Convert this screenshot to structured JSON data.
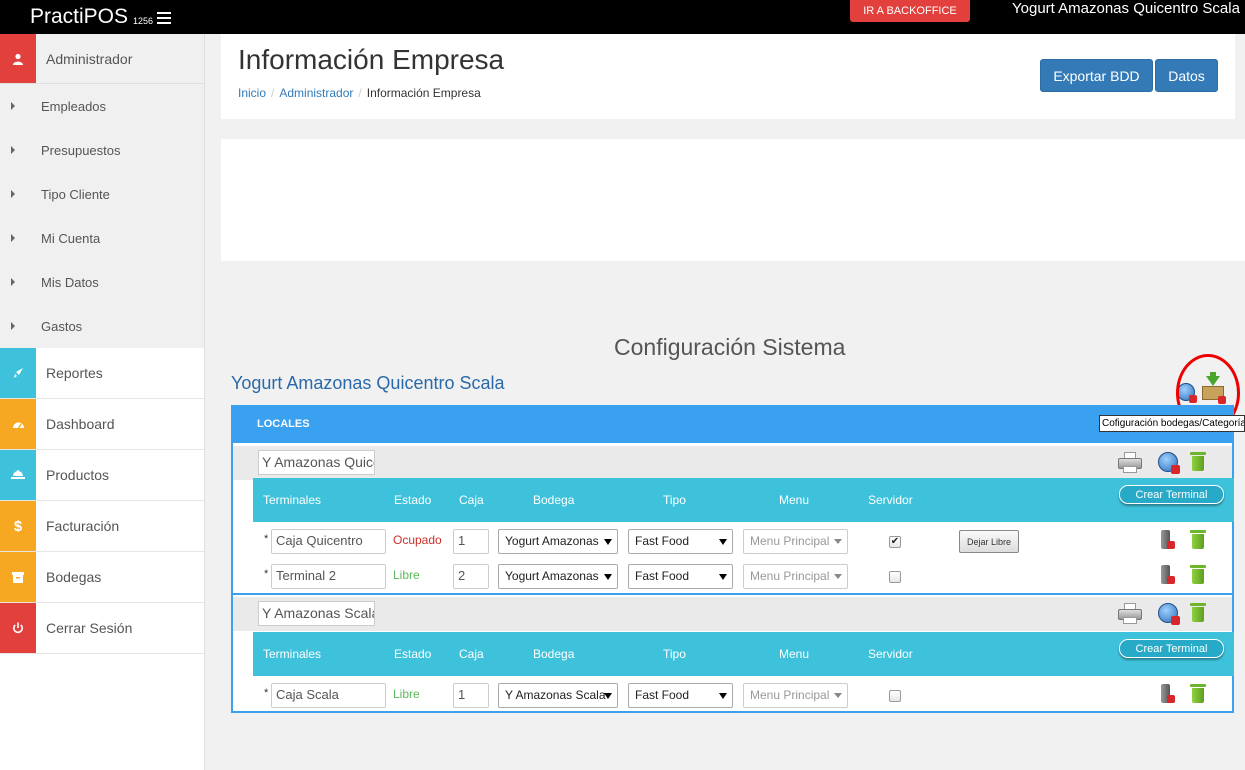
{
  "topbar": {
    "brand": "PractiPOS",
    "version": "1256",
    "backoffice_label": "IR A BACKOFFICE",
    "store_name": "Yogurt Amazonas Quicentro Scala"
  },
  "sidebar": {
    "section": "Administrador",
    "subitems": [
      "Empleados",
      "Presupuestos",
      "Tipo Cliente",
      "Mi Cuenta",
      "Mis Datos",
      "Gastos"
    ],
    "items": [
      {
        "label": "Reportes",
        "color": "#3ec2db",
        "icon": "rocket-icon"
      },
      {
        "label": "Dashboard",
        "color": "#f7a823",
        "icon": "dashboard-icon"
      },
      {
        "label": "Productos",
        "color": "#3ec2db",
        "icon": "products-icon"
      },
      {
        "label": "Facturación",
        "color": "#f7a823",
        "icon": "dollar-icon"
      },
      {
        "label": "Bodegas",
        "color": "#f7a823",
        "icon": "warehouse-icon"
      },
      {
        "label": "Cerrar Sesión",
        "color": "#e2403d",
        "icon": "power-icon"
      }
    ]
  },
  "header": {
    "title": "Información Empresa",
    "breadcrumb": [
      "Inicio",
      "Administrador",
      "Información Empresa"
    ],
    "export_label": "Exportar BDD",
    "datos_label": "Datos"
  },
  "config": {
    "title": "Configuración Sistema",
    "store_title": "Yogurt Amazonas Quicentro Scala",
    "tooltip": "Cofiguración bodegas/Categorías",
    "locales_label": "LOCALES"
  },
  "table_headers": {
    "terminales": "Terminales",
    "estado": "Estado",
    "caja": "Caja",
    "bodega": "Bodega",
    "tipo": "Tipo",
    "menu": "Menu",
    "servidor": "Servidor",
    "crear": "Crear Terminal"
  },
  "locales": [
    {
      "name": "Y Amazonas Quicentro",
      "terminals": [
        {
          "name": "Caja Quicentro",
          "estado": "Ocupado",
          "caja": "1",
          "bodega": "Yogurt Amazonas",
          "tipo": "Fast Food",
          "menu": "Menu Principal",
          "servidor": true,
          "action": "Dejar Libre"
        },
        {
          "name": "Terminal 2",
          "estado": "Libre",
          "caja": "2",
          "bodega": "Yogurt Amazonas",
          "tipo": "Fast Food",
          "menu": "Menu Principal",
          "servidor": false
        }
      ]
    },
    {
      "name": "Y Amazonas Scala",
      "terminals": [
        {
          "name": "Caja Scala",
          "estado": "Libre",
          "caja": "1",
          "bodega": "Y Amazonas Scala",
          "tipo": "Fast Food",
          "menu": "Menu Principal",
          "servidor": false
        }
      ]
    }
  ],
  "colors": {
    "ocupado": "#c9302c",
    "libre": "#5cb85c",
    "accent_blue": "#3aa0f0",
    "teal": "#3ec2db"
  }
}
